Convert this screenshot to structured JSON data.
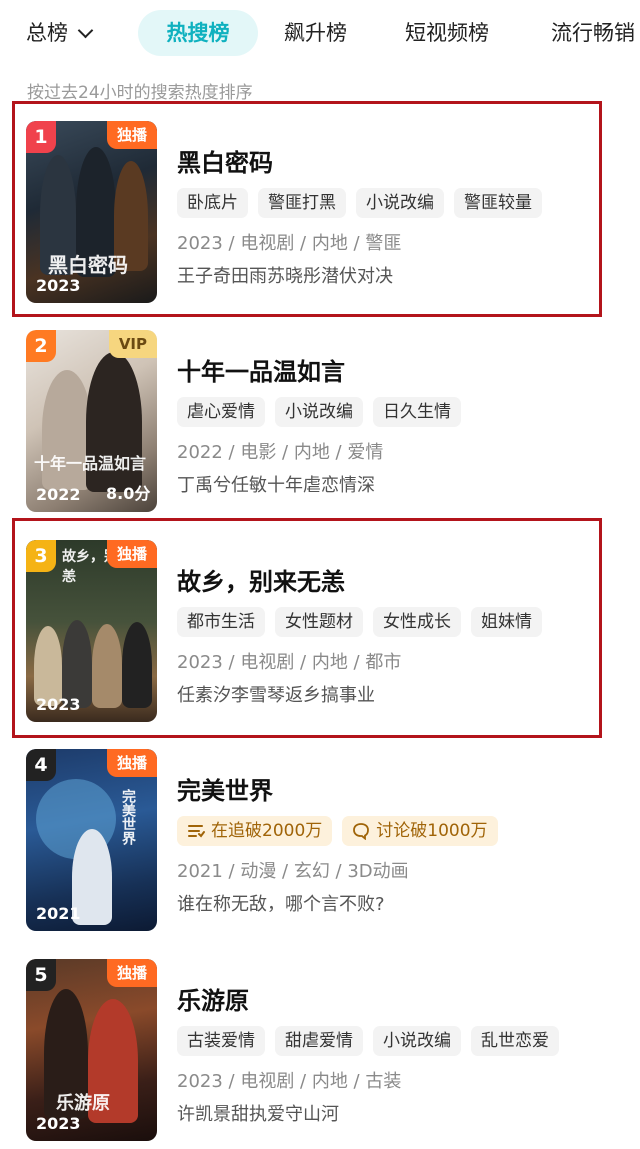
{
  "tabs": {
    "all_label": "总榜",
    "items": [
      "热搜榜",
      "飙升榜",
      "短视频榜",
      "流行畅销"
    ]
  },
  "subtitle": "按过去24小时的搜索热度排序",
  "list": [
    {
      "rank": "1",
      "rank_color": "#f0424c",
      "badge": "独播",
      "poster_year": "2023",
      "poster_score": "",
      "poster_calligraphy": "黑白密码",
      "title": "黑白密码",
      "tags": [
        "卧底片",
        "警匪打黑",
        "小说改编",
        "警匪较量"
      ],
      "meta": "2023 / 电视剧 / 内地 / 警匪",
      "desc": "王子奇田雨苏晓彤潜伏对决"
    },
    {
      "rank": "2",
      "rank_color": "#ff7a22",
      "badge": "VIP",
      "poster_year": "2022",
      "poster_score": "8.0分",
      "poster_calligraphy": "十年一品温如言",
      "title": "十年一品温如言",
      "tags": [
        "虐心爱情",
        "小说改编",
        "日久生情"
      ],
      "meta": "2022 / 电影 / 内地 / 爱情",
      "desc": "丁禹兮任敏十年虐恋情深"
    },
    {
      "rank": "3",
      "rank_color": "#f5b315",
      "badge": "独播",
      "poster_year": "2023",
      "poster_score": "",
      "poster_calligraphy": "故乡，别来无恙",
      "title": "故乡，别来无恙",
      "tags": [
        "都市生活",
        "女性题材",
        "女性成长",
        "姐妹情"
      ],
      "meta": "2023 / 电视剧 / 内地 / 都市",
      "desc": "任素汐李雪琴返乡搞事业"
    },
    {
      "rank": "4",
      "rank_color": "#222222",
      "badge": "独播",
      "poster_year": "2021",
      "poster_score": "",
      "poster_calligraphy": "完美世界",
      "title": "完美世界",
      "hot_tags": [
        {
          "icon": "list-icon",
          "label": "在追破2000万"
        },
        {
          "icon": "comment-icon",
          "label": "讨论破1000万"
        }
      ],
      "meta": "2021 / 动漫 / 玄幻 / 3D动画",
      "desc": "谁在称无敌，哪个言不败?"
    },
    {
      "rank": "5",
      "rank_color": "#222222",
      "badge": "独播",
      "poster_year": "2023",
      "poster_score": "",
      "poster_calligraphy": "乐游原",
      "title": "乐游原",
      "tags": [
        "古装爱情",
        "甜虐爱情",
        "小说改编",
        "乱世恋爱"
      ],
      "meta": "2023 / 电视剧 / 内地 / 古装",
      "desc": "许凯景甜执爱守山河"
    }
  ]
}
